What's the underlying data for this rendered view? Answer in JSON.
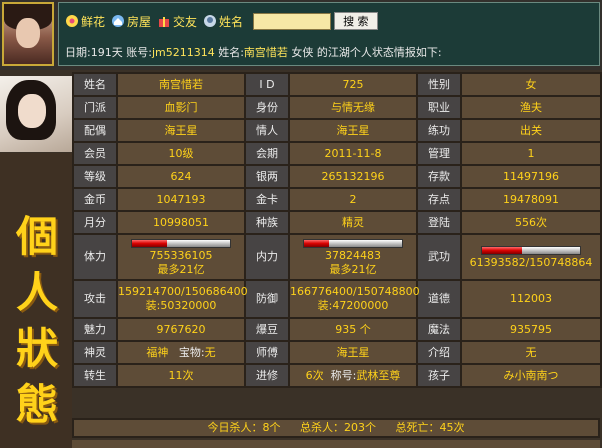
{
  "nav": {
    "items": [
      {
        "label": "鲜花",
        "icon": "flower-icon"
      },
      {
        "label": "房屋",
        "icon": "house-icon"
      },
      {
        "label": "交友",
        "icon": "gift-icon"
      },
      {
        "label": "姓名",
        "icon": "search-person-icon"
      }
    ],
    "search_button": "搜 索",
    "search_value": ""
  },
  "info": {
    "date_label": "日期:",
    "date_value": "191天",
    "account_label": "账号:",
    "account_value": "jm5211314",
    "name_label": "姓名:",
    "name_value": "南宫惜若",
    "gender_title": "女侠",
    "suffix": "的江湖个人状态情报如下:"
  },
  "title": "個人狀態",
  "rows": [
    [
      {
        "l": "姓名"
      },
      {
        "v": "南宫惜若"
      },
      {
        "l": "I D"
      },
      {
        "v": "725"
      },
      {
        "l": "性别"
      },
      {
        "v": "女"
      }
    ],
    [
      {
        "l": "门派"
      },
      {
        "v": "血影门"
      },
      {
        "l": "身份"
      },
      {
        "v": "与情无缘"
      },
      {
        "l": "职业"
      },
      {
        "v": "渔夫"
      }
    ],
    [
      {
        "l": "配偶"
      },
      {
        "v": "海王星"
      },
      {
        "l": "情人"
      },
      {
        "v": "海王星"
      },
      {
        "l": "练功"
      },
      {
        "v": "出关"
      }
    ],
    [
      {
        "l": "会员"
      },
      {
        "v": "10级"
      },
      {
        "l": "会期"
      },
      {
        "v": "2011-11-8"
      },
      {
        "l": "管理"
      },
      {
        "v": "1"
      }
    ],
    [
      {
        "l": "等级"
      },
      {
        "v": "624"
      },
      {
        "l": "银两"
      },
      {
        "v": "265132196"
      },
      {
        "l": "存款"
      },
      {
        "v": "11497196"
      }
    ],
    [
      {
        "l": "金币"
      },
      {
        "v": "1047193"
      },
      {
        "l": "金卡"
      },
      {
        "v": "2"
      },
      {
        "l": "存点"
      },
      {
        "v": "19478091"
      }
    ],
    [
      {
        "l": "月分"
      },
      {
        "v": "10998051"
      },
      {
        "l": "种族"
      },
      {
        "v": "精灵"
      },
      {
        "l": "登陆"
      },
      {
        "v": "556次"
      }
    ]
  ],
  "stats_bars": {
    "hp": {
      "label": "体力",
      "value": "755336105",
      "max": "最多21亿",
      "fill": 0.36
    },
    "mp": {
      "label": "内力",
      "value": "37824483",
      "max": "最多21亿",
      "fill": 0.25
    },
    "skill": {
      "label": "武功",
      "value": "61393582/150748864",
      "fill": 0.41
    }
  },
  "attack": {
    "label": "攻击",
    "line1": "159214700/150686400",
    "line2": "装:50320000"
  },
  "defense": {
    "label": "防御",
    "line1": "166776400/150748800",
    "line2": "装:47200000"
  },
  "morality": {
    "label": "道德",
    "value": "112003"
  },
  "rows2": [
    [
      {
        "l": "魅力"
      },
      {
        "v": "9767620"
      },
      {
        "l": "爆豆"
      },
      {
        "v": "935 个"
      },
      {
        "l": "魔法"
      },
      {
        "v": "935795"
      }
    ]
  ],
  "beast": {
    "label": "神灵",
    "pet": "福神",
    "treasure_label": "宝物:",
    "treasure": "无"
  },
  "master": {
    "label": "师傅",
    "value": "海王星"
  },
  "intro": {
    "label": "介绍",
    "value": "无"
  },
  "rebirth": {
    "label": "转生",
    "value": "11次"
  },
  "advance": {
    "label": "进修",
    "count": "6次",
    "title_label": "称号:",
    "title": "武林至尊"
  },
  "child": {
    "label": "孩子",
    "value": "み小南南つ"
  },
  "footer": {
    "today_kills": "今日杀人：8个",
    "total_kills": "总杀人：203个",
    "total_deaths": "总死亡：45次"
  }
}
